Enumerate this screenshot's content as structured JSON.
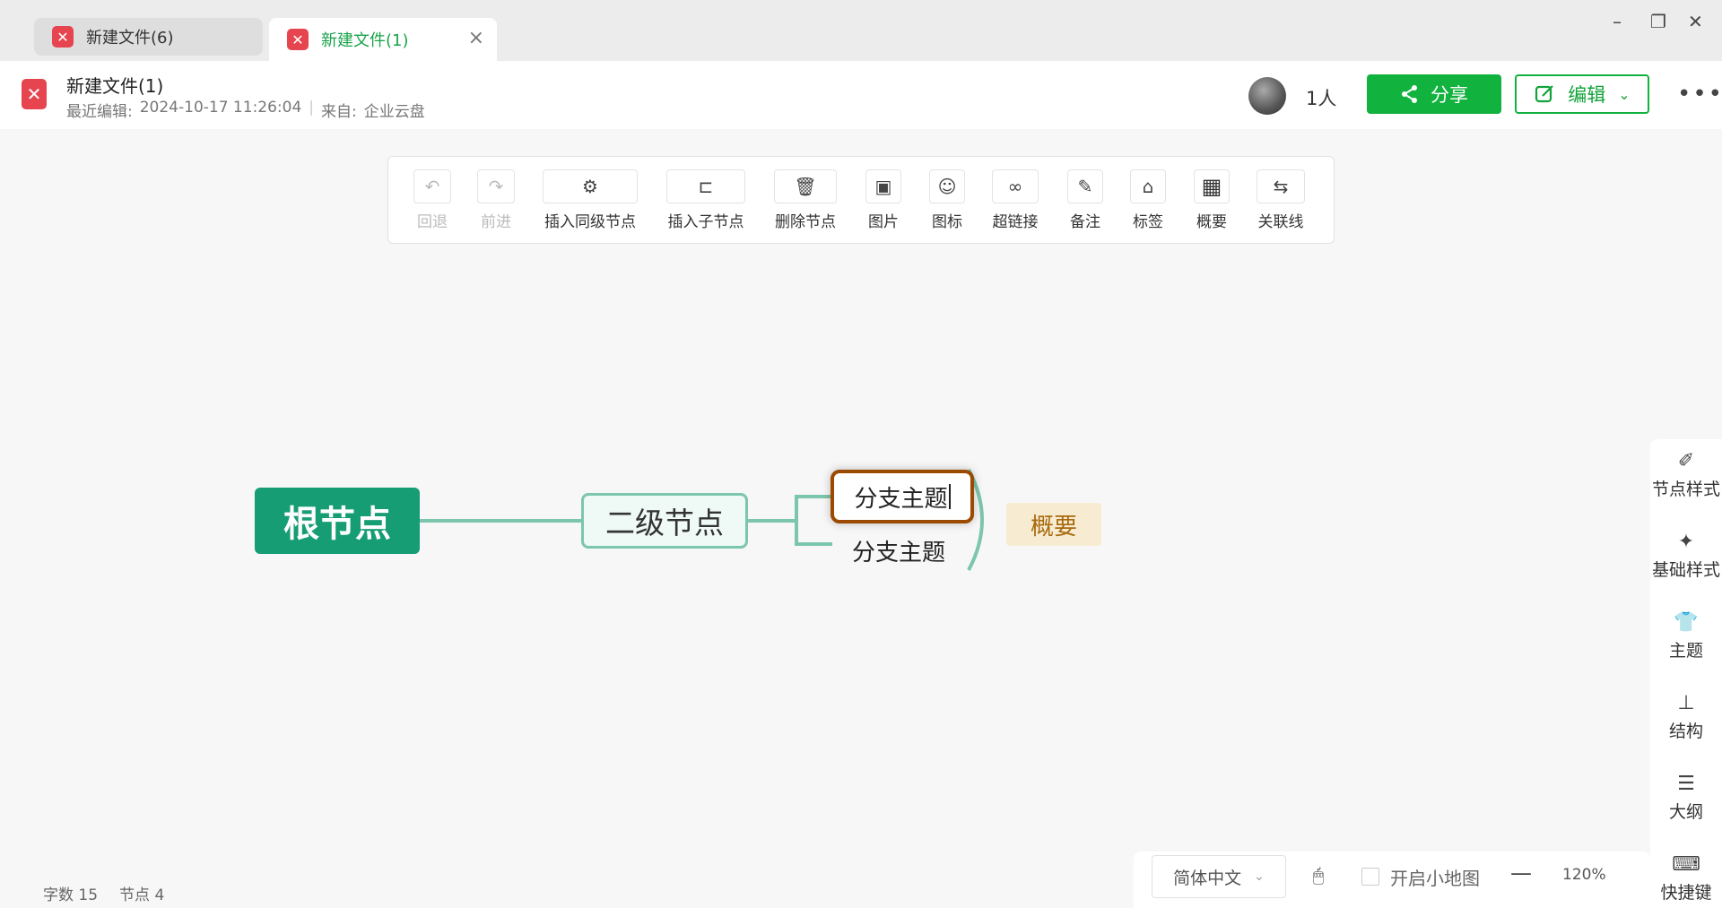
{
  "tabs": [
    {
      "label": "新建文件(6)",
      "active": false
    },
    {
      "label": "新建文件(1)",
      "active": true
    }
  ],
  "window_controls": {
    "minimize": "–",
    "restore": "❐",
    "close": "✕"
  },
  "header": {
    "title": "新建文件(1)",
    "last_edit_label": "最近编辑:",
    "last_edit_time": "2024-10-17 11:26:04",
    "source_label": "来自:",
    "source_value": "企业云盘",
    "users_count": "1人",
    "share_label": "分享",
    "edit_label": "编辑",
    "more": "•••"
  },
  "toolbar": {
    "undo": "回退",
    "redo": "前进",
    "insert_sibling": "插入同级节点",
    "insert_child": "插入子节点",
    "delete_node": "删除节点",
    "image": "图片",
    "icon": "图标",
    "hyperlink": "超链接",
    "note": "备注",
    "tag": "标签",
    "summary": "概要",
    "relation_line": "关联线"
  },
  "mindmap": {
    "root": "根节点",
    "level2": "二级节点",
    "branch_selected": "分支主题",
    "branch_2": "分支主题",
    "summary": "概要"
  },
  "right_panel": {
    "node_style": "节点样式",
    "basic_style": "基础样式",
    "theme": "主题",
    "structure": "结构",
    "outline": "大纲",
    "shortcuts": "快捷键"
  },
  "status": {
    "word_count_label": "字数",
    "word_count": "15",
    "node_count_label": "节点",
    "node_count": "4"
  },
  "bottom": {
    "language": "简体中文",
    "minimap_label": "开启小地图",
    "zoom_minus": "—",
    "zoom": "120%"
  },
  "colors": {
    "brand_green": "#12b23f",
    "root_node": "#169d73",
    "connector": "#7cc6ad",
    "selected_border": "#9b4a00",
    "summary_bg": "#f7ecd2"
  }
}
